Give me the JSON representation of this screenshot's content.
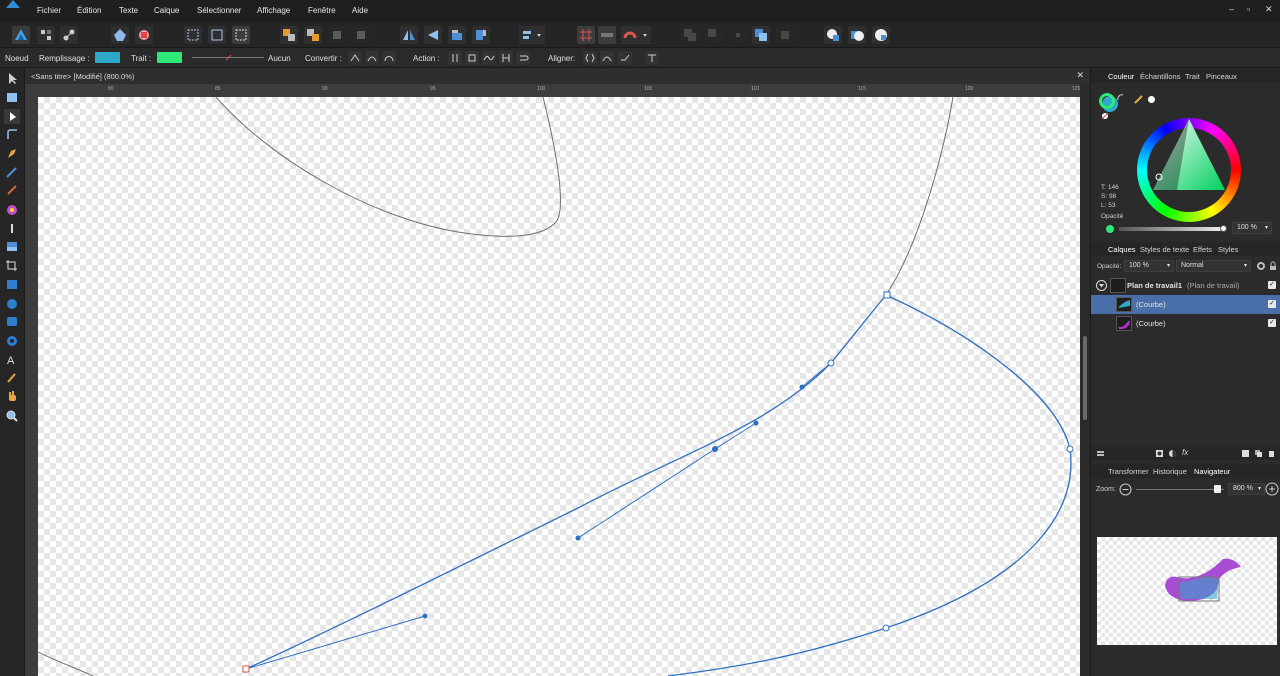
{
  "menu": {
    "items": [
      "Fichier",
      "Édition",
      "Texte",
      "Calque",
      "Sélectionner",
      "Affichage",
      "Fenêtre",
      "Aide"
    ],
    "window_controls": [
      "–",
      "▫",
      "✕"
    ]
  },
  "context_bar": {
    "tool_name": "Noeud",
    "fill_label": "Remplissage :",
    "fill_color": "#2fa9c9",
    "stroke_label": "Trait :",
    "stroke_color": "#2fe87a",
    "stroke_width_value": "Aucun",
    "convert_label": "Convertir :",
    "action_label": "Action :",
    "align_label": "Aligner:"
  },
  "document": {
    "tab_title": "<Sans titre> [Modifié] (800.0%)",
    "close": "✕",
    "ruler_ticks": [
      "80",
      "85",
      "90",
      "95",
      "100",
      "105",
      "110",
      "115",
      "120",
      "125"
    ]
  },
  "color_panel": {
    "tabs": [
      "Couleur",
      "Échantillons",
      "Trait",
      "Pinceaux"
    ],
    "active_tab": "Couleur",
    "hsl_t": "T: 146",
    "hsl_s": "S: 98",
    "hsl_l": "L: 53",
    "opacity_label": "Opacité",
    "opacity_value": "100 %",
    "swatch_fill": "#2fa9c9",
    "swatch_stroke": "#2fe87a"
  },
  "layers_panel": {
    "tabs": [
      "Calques",
      "Styles de texte",
      "Effets",
      "Styles"
    ],
    "active_tab": "Calques",
    "opacity_label": "Opacité:",
    "opacity_value": "100 %",
    "blend_mode": "Normal",
    "rows": [
      {
        "name": "Plan de travail1",
        "sub": "(Plan de travail)",
        "selected": false
      },
      {
        "name": "(Courbe)",
        "selected": true
      },
      {
        "name": "(Courbe)",
        "selected": false
      }
    ]
  },
  "navigator_panel": {
    "tabs": [
      "Transformer",
      "Historique",
      "Navigateur"
    ],
    "active_tab": "Navigateur",
    "zoom_label": "Zoom:",
    "zoom_value": "800 %",
    "zoom_fraction": 0.92
  },
  "colors": {
    "accent": "#4a7bbd",
    "path": "#2e6fc0",
    "selection_row": "#4a6fa8"
  }
}
